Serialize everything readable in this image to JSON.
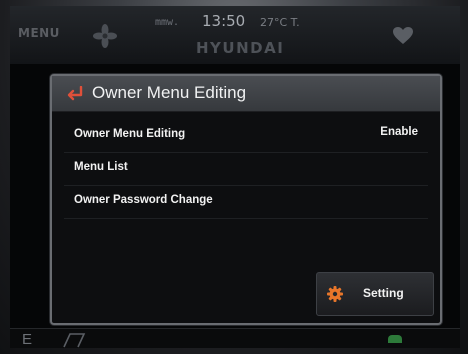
{
  "topbar": {
    "menu_label": "MENU",
    "date": "mmw.",
    "time": "13:50",
    "temperature": "27°C T.",
    "brand": "HYUNDAI"
  },
  "dialog": {
    "title": "Owner Menu Editing",
    "rows": [
      {
        "label": "Owner Menu Editing",
        "value": "Enable"
      },
      {
        "label": "Menu List",
        "value": ""
      },
      {
        "label": "Owner Password Change",
        "value": ""
      }
    ],
    "setting_label": "Setting"
  },
  "bottombar": {
    "gear_position": "E"
  },
  "colors": {
    "accent_orange": "#e8762a",
    "back_arrow": "#e0503a",
    "indicator_green": "#2d7a3a"
  },
  "icons": {
    "fan": "fan-icon",
    "favorite": "heart-icon",
    "back": "back-arrow-icon",
    "setting": "gear-icon",
    "route": "flag-icon"
  }
}
